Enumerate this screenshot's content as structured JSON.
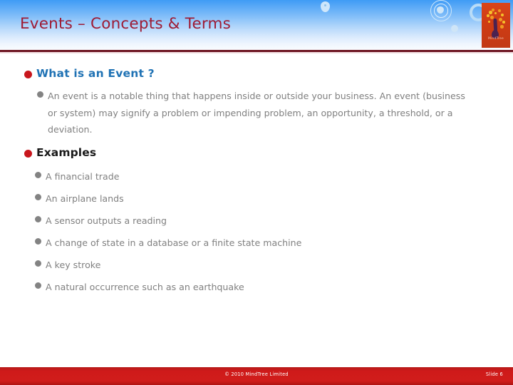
{
  "header": {
    "title": "Events – Concepts & Terms",
    "logo": {
      "caption": "MindTree",
      "name": "mindtree-logo"
    }
  },
  "content": {
    "sections": [
      {
        "heading": "What is an Event ?",
        "heading_style": "blue",
        "body": [
          "An event is a notable thing that happens inside or outside your business. An event (business or system) may signify a problem or impending problem, an opportunity, a threshold, or a deviation."
        ]
      },
      {
        "heading": "Examples",
        "heading_style": "dark",
        "body": [
          "A financial trade",
          "An airplane lands",
          "A sensor outputs a reading",
          "A change of state in a database or a finite state machine",
          "A key stroke",
          "A natural occurrence such as an earthquake"
        ]
      }
    ]
  },
  "footer": {
    "copyright": "© 2010 MindTree Limited",
    "slide_label": "Slide 6"
  },
  "colors": {
    "title_maroon": "#9e1b34",
    "heading_blue": "#1f72b4",
    "heading_dark": "#1a1a1a",
    "body_gray": "#808080",
    "bullet_red": "#c8161d",
    "bullet_gray": "#838383",
    "footer_red": "#cf1a1a",
    "rule_maroon": "#6d1421",
    "header_blue": "#3f9bf5"
  }
}
